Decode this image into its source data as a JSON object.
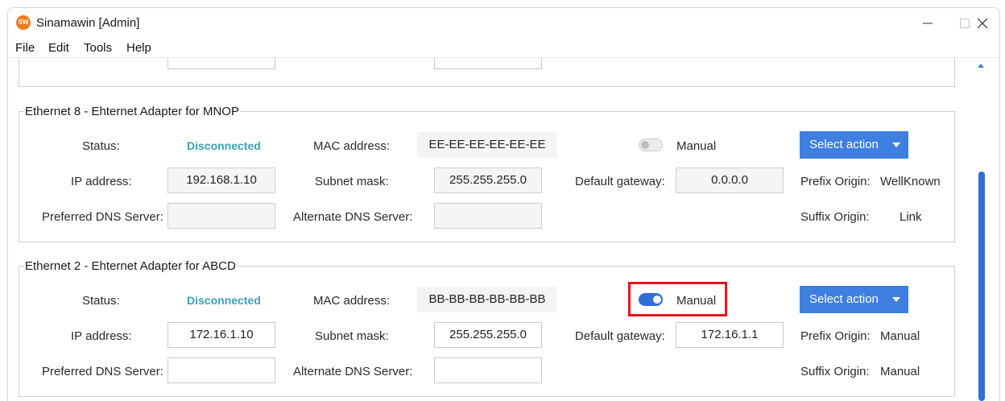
{
  "window": {
    "title": "Sinamawin [Admin]",
    "app_icon_text": "SW"
  },
  "menu": {
    "file": "File",
    "edit": "Edit",
    "tools": "Tools",
    "help": "Help"
  },
  "adapters": [
    {
      "legend": "Ethernet 8 - Ehternet Adapter for MNOP",
      "status_label": "Status:",
      "status_value": "Disconnected",
      "mac_label": "MAC address:",
      "mac_value": "EE-EE-EE-EE-EE-EE",
      "toggle_on": false,
      "toggle_label": "Manual",
      "action_button": "Select action",
      "ip_label": "IP address:",
      "ip_value": "192.168.1.10",
      "subnet_label": "Subnet mask:",
      "subnet_value": "255.255.255.0",
      "gateway_label": "Default gateway:",
      "gateway_value": "0.0.0.0",
      "prefix_label": "Prefix Origin:",
      "prefix_value": "WellKnown",
      "pdns_label": "Preferred DNS Server:",
      "pdns_value": "",
      "adns_label": "Alternate DNS Server:",
      "adns_value": "",
      "suffix_label": "Suffix Origin:",
      "suffix_value": "Link"
    },
    {
      "legend": "Ethernet 2 - Ehternet Adapter for ABCD",
      "status_label": "Status:",
      "status_value": "Disconnected",
      "mac_label": "MAC address:",
      "mac_value": "BB-BB-BB-BB-BB-BB",
      "toggle_on": true,
      "toggle_label": "Manual",
      "action_button": "Select action",
      "ip_label": "IP address:",
      "ip_value": "172.16.1.10",
      "subnet_label": "Subnet mask:",
      "subnet_value": "255.255.255.0",
      "gateway_label": "Default gateway:",
      "gateway_value": "172.16.1.1",
      "prefix_label": "Prefix Origin:",
      "prefix_value": "Manual",
      "pdns_label": "Preferred DNS Server:",
      "pdns_value": "",
      "adns_label": "Alternate DNS Server:",
      "adns_value": "",
      "suffix_label": "Suffix Origin:",
      "suffix_value": "Manual"
    }
  ],
  "colors": {
    "accent": "#3f7fe0",
    "status_disconnected": "#3aa1b5",
    "highlight": "#e8121b"
  }
}
